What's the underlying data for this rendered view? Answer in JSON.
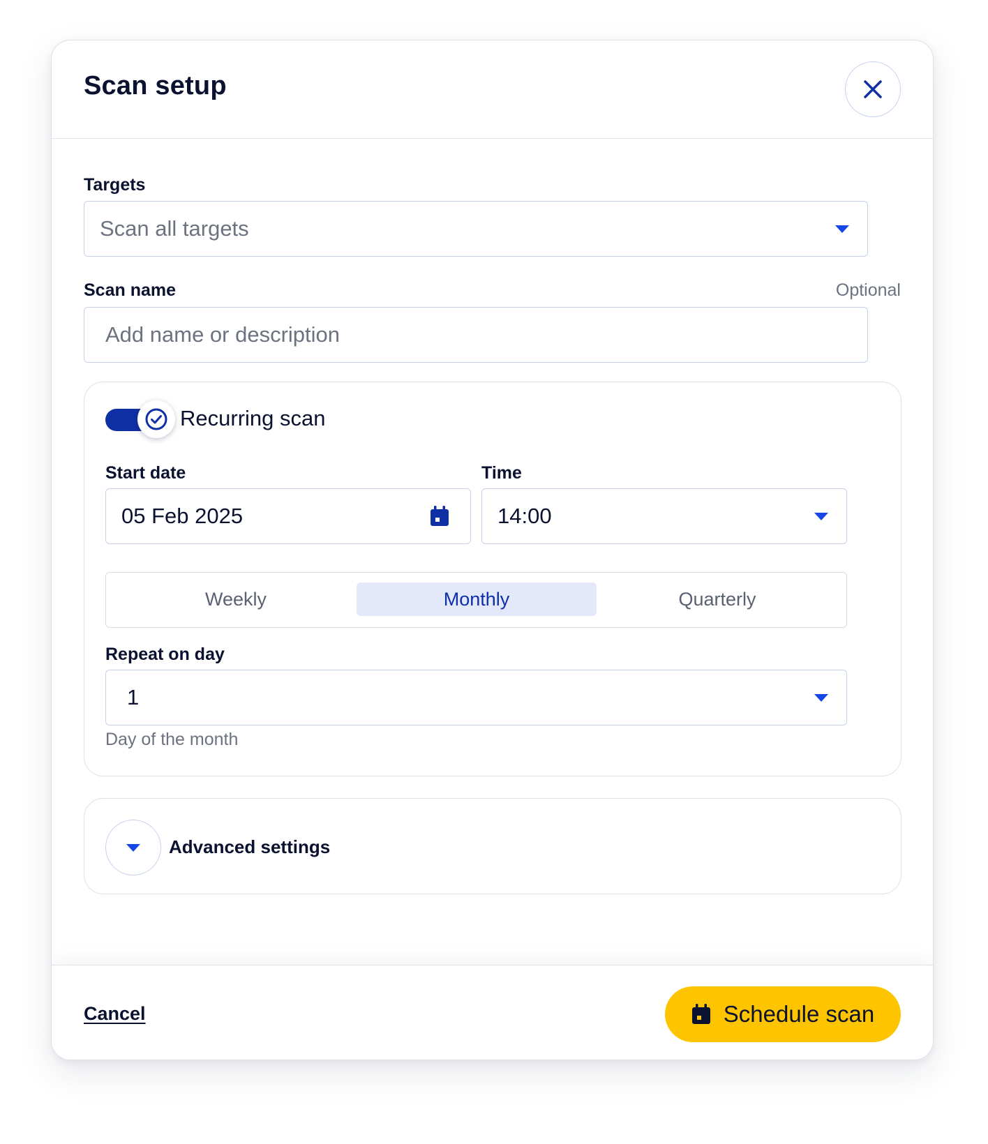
{
  "modal": {
    "title": "Scan setup",
    "close_icon": "close-icon"
  },
  "targets": {
    "label": "Targets",
    "value": "Scan all targets",
    "icon": "chevron-down-icon"
  },
  "scan_name": {
    "label": "Scan name",
    "optional_text": "Optional",
    "placeholder": "Add name or description",
    "value": ""
  },
  "recurring": {
    "enabled": true,
    "label": "Recurring scan",
    "toggle_icon": "check-circle-icon",
    "start_date": {
      "label": "Start date",
      "value": "05 Feb 2025",
      "icon": "calendar-icon"
    },
    "time": {
      "label": "Time",
      "value": "14:00",
      "icon": "chevron-down-icon"
    },
    "frequency": {
      "options": [
        "Weekly",
        "Monthly",
        "Quarterly"
      ],
      "selected": "Monthly"
    },
    "repeat_on_day": {
      "label": "Repeat on day",
      "value": "1",
      "helper": "Day of the month",
      "icon": "chevron-down-icon"
    }
  },
  "advanced": {
    "label": "Advanced settings",
    "icon": "chevron-down-icon"
  },
  "footer": {
    "cancel_label": "Cancel",
    "primary_label": "Schedule scan",
    "primary_icon": "calendar-icon"
  },
  "colors": {
    "accent": "#0f2fa5",
    "accent_bright": "#1447e6",
    "primary_button": "#ffc400",
    "selected_tab_bg": "#e3e9fb",
    "border": "#dde1e8",
    "text": "#0b1230",
    "muted_text": "#6c7280"
  }
}
